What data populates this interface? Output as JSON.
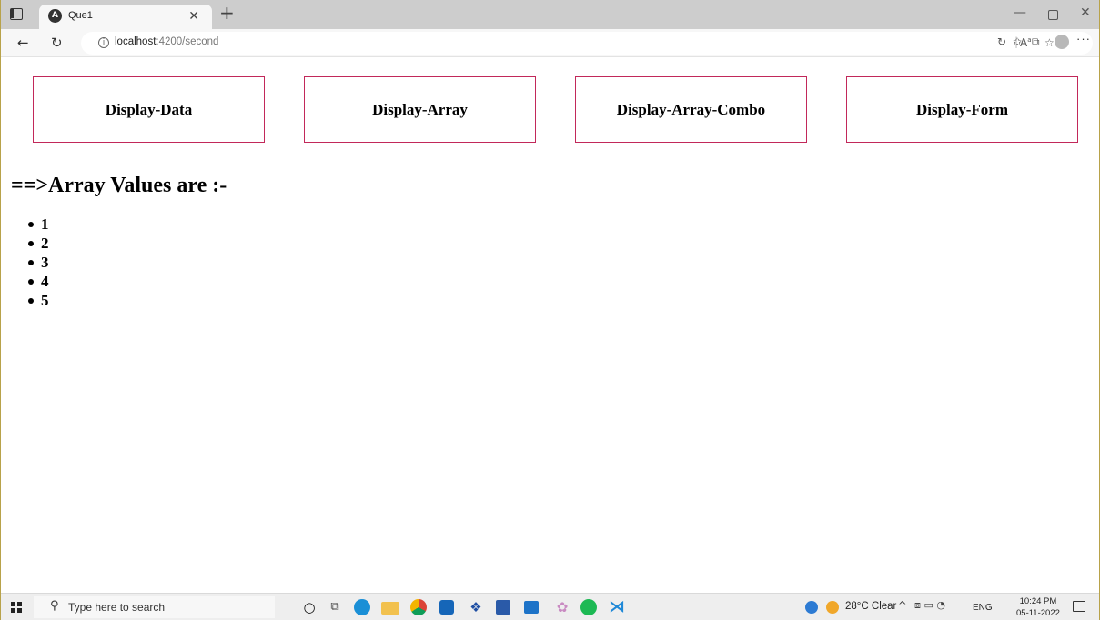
{
  "browser": {
    "tab": {
      "title": "Que1",
      "favicon_icon": "angular-icon"
    },
    "address": {
      "host": "localhost",
      "path": ":4200/second"
    }
  },
  "nav": {
    "buttons": [
      {
        "label": "Display-Data"
      },
      {
        "label": "Display-Array"
      },
      {
        "label": "Display-Array-Combo"
      },
      {
        "label": "Display-Form"
      }
    ],
    "border_color": "#c2285a"
  },
  "main": {
    "heading": "==>Array Values are :-",
    "values": [
      "1",
      "2",
      "3",
      "4",
      "5"
    ]
  },
  "taskbar": {
    "search_placeholder": "Type here to search",
    "weather": "28°C  Clear",
    "language": "ENG",
    "time": "10:24 PM",
    "date": "05-11-2022"
  }
}
